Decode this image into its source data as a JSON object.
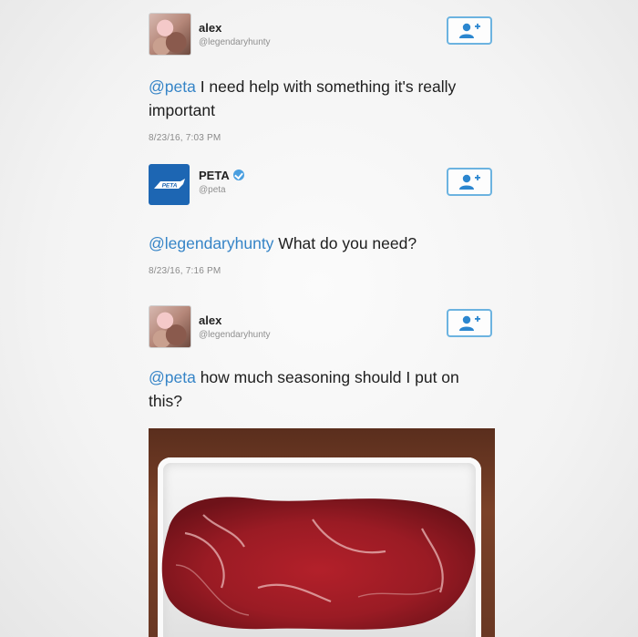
{
  "tweets": [
    {
      "display_name": "alex",
      "handle": "@legendaryhunty",
      "mention": "@peta",
      "text": " I need help with something it's really important",
      "timestamp": "8/23/16, 7:03 PM",
      "avatar_icon": "user-avatar-photo",
      "follow_icon": "add-user-icon"
    },
    {
      "display_name": "PETA",
      "handle": "@peta",
      "verified": true,
      "mention": "@legendaryhunty",
      "text": " What do you need?",
      "timestamp": "8/23/16, 7:16 PM",
      "avatar_icon": "peta-logo",
      "follow_icon": "add-user-icon"
    },
    {
      "display_name": "alex",
      "handle": "@legendaryhunty",
      "mention": "@peta",
      "text": " how much seasoning should I put on this?",
      "avatar_icon": "user-avatar-photo",
      "follow_icon": "add-user-icon",
      "media": "raw-steak-photo"
    }
  ],
  "colors": {
    "mention": "#3584c7",
    "follow_border": "#6cb3e0",
    "peta_blue": "#1d66b3",
    "verified": "#4a9fe0"
  },
  "peta_logo_text": "PETA"
}
